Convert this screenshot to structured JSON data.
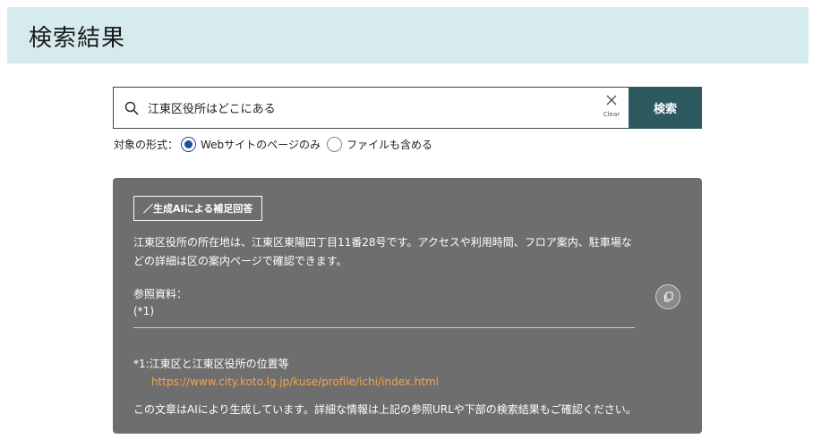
{
  "page": {
    "title": "検索結果"
  },
  "search": {
    "query": "江東区役所はどこにある",
    "clear_label": "Clear",
    "button_label": "検索"
  },
  "scope": {
    "label": "対象の形式：",
    "options": [
      {
        "label": "Webサイトのページのみ",
        "checked": true
      },
      {
        "label": "ファイルも含める",
        "checked": false
      }
    ]
  },
  "ai_answer": {
    "badge": "／生成AIによる補足回答",
    "text": "江東区役所の所在地は、江東区東陽四丁目11番28号です。アクセスや利用時間、フロア案内、駐車場などの詳細は区の案内ページで確認できます。",
    "references_label": "参照資料：",
    "reference_marker": "(*1)",
    "citation_title": "*1:江東区と江東区役所の位置等",
    "citation_url": "https://www.city.koto.lg.jp/kuse/profile/ichi/index.html",
    "disclaimer": "この文章はAIにより生成しています。詳細な情報は上記の参照URLや下部の検索結果もご確認ください。"
  },
  "colors": {
    "header_bg": "#d6ebee",
    "search_button": "#2c5a5e",
    "panel_bg": "#6e6e6e",
    "link": "#f7a34a",
    "radio_accent": "#1d4f9c"
  },
  "icons": {
    "search": "search-icon",
    "clear": "close-icon",
    "copy": "copy-icon"
  }
}
